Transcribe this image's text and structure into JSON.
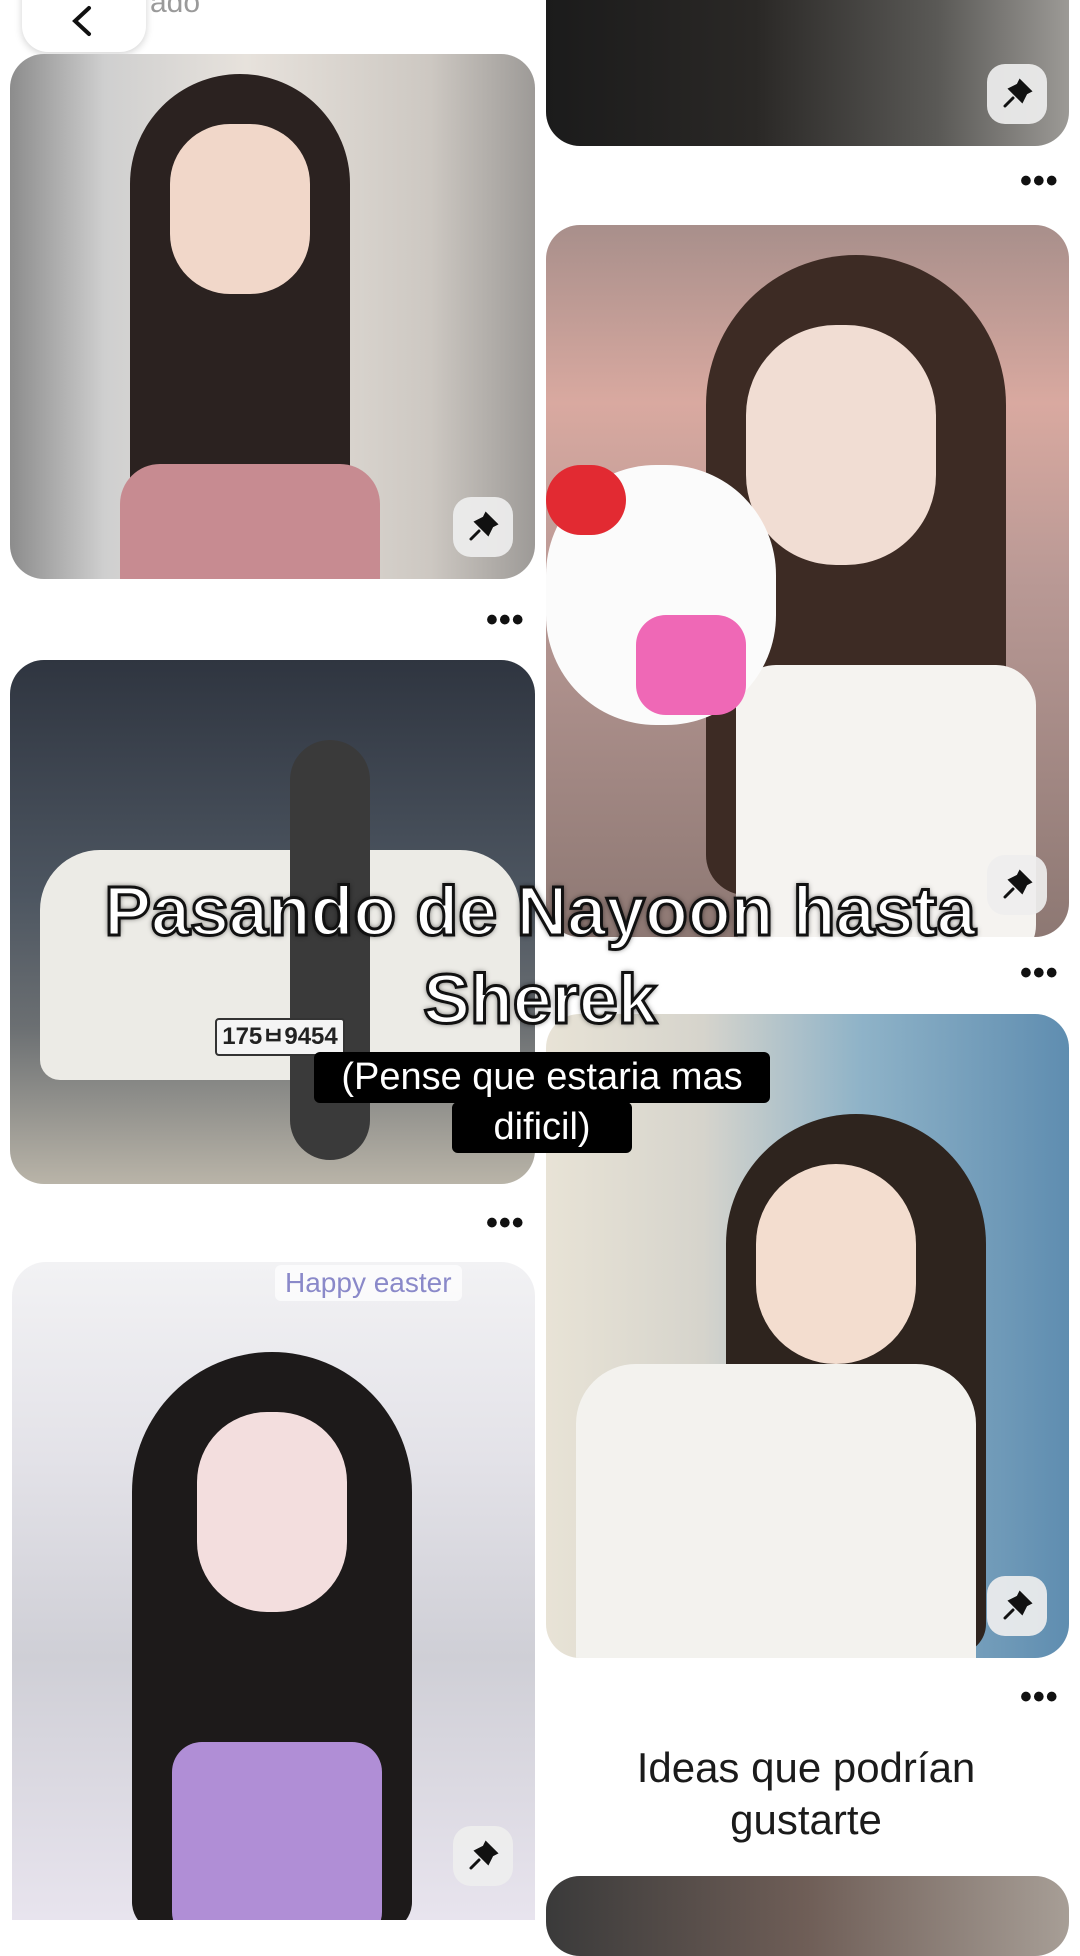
{
  "header": {
    "back_label": "",
    "partial_title": "ado"
  },
  "pins": [
    {
      "id": "pin1"
    },
    {
      "id": "pin2"
    },
    {
      "id": "pin3"
    },
    {
      "id": "pin4"
    },
    {
      "id": "pin5"
    },
    {
      "id": "pin6"
    },
    {
      "id": "pin7"
    }
  ],
  "image_text": {
    "plate": "175ㅂ9454",
    "easter": "Happy easter"
  },
  "overlay": {
    "title_line1": "Pasando de Nayoon hasta",
    "title_line2": "Sherek",
    "caption_line1": "(Pense que estaria mas",
    "caption_line2": "dificil)"
  },
  "more_label": "•••",
  "ideas": {
    "line1": "Ideas que podrían",
    "line2": "gustarte"
  },
  "colors": {
    "background": "#ffffff",
    "save_button": "#eeeeee"
  }
}
